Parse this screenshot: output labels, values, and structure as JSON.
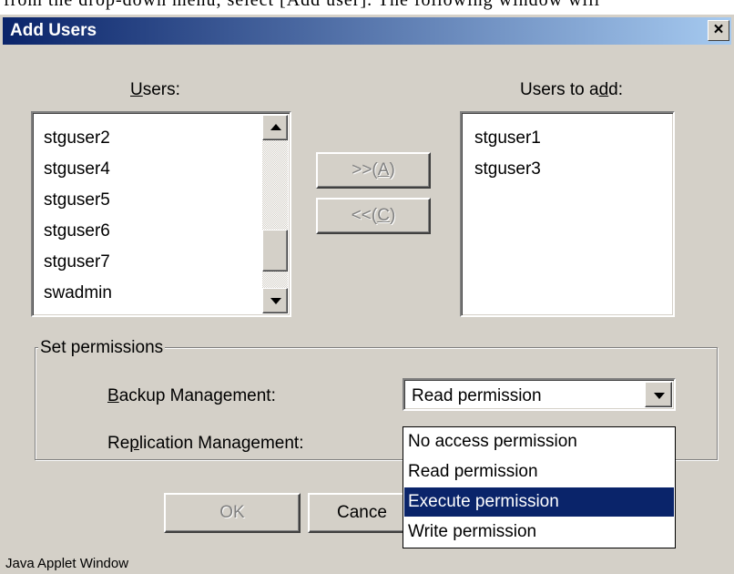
{
  "doc_caption": "from the drop-down menu, select [Add user]. The following window will",
  "window": {
    "title": "Add Users",
    "close_glyph": "×"
  },
  "users_list": {
    "label_prefix": "",
    "label_mnemonic": "U",
    "label_suffix": "sers:",
    "items": [
      "stguser2",
      "stguser4",
      "stguser5",
      "stguser6",
      "stguser7",
      "swadmin"
    ]
  },
  "users_to_add": {
    "label_prefix": "Users to a",
    "label_mnemonic": "d",
    "label_suffix": "d:",
    "items": [
      "stguser1",
      "stguser3"
    ]
  },
  "move_buttons": {
    "add_prefix": ">>(",
    "add_mnemonic": "A",
    "add_suffix": ")",
    "remove_prefix": "<<(",
    "remove_mnemonic": "C",
    "remove_suffix": ")"
  },
  "permissions": {
    "legend": "Set permissions",
    "backup_prefix": "",
    "backup_mnemonic": "B",
    "backup_suffix": "ackup Management:",
    "replication_prefix": "Re",
    "replication_mnemonic": "p",
    "replication_suffix": "lication Management:",
    "backup_selected": "Read permission",
    "options": [
      "No access permission",
      "Read permission",
      "Execute permission",
      "Write permission"
    ],
    "highlighted_option": "Execute permission"
  },
  "buttons": {
    "ok": "OK",
    "cancel": "Cance"
  },
  "footer": "Java Applet Window"
}
